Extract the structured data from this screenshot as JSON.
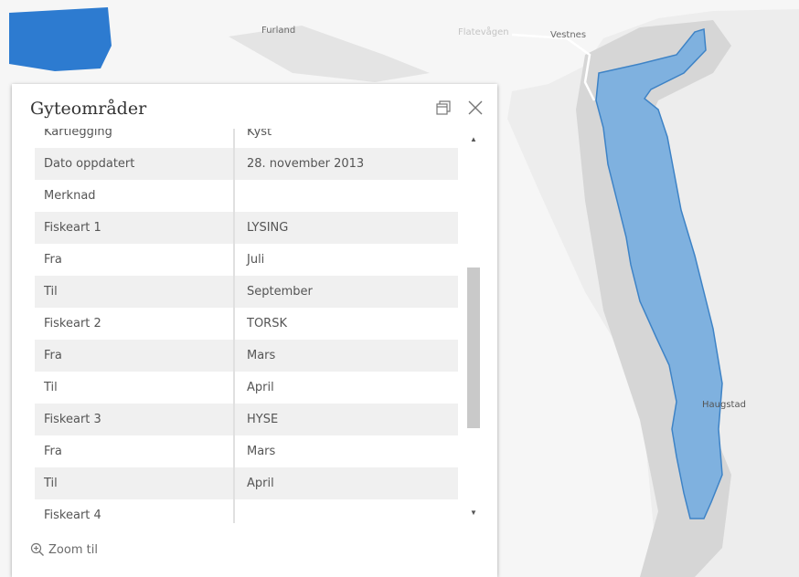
{
  "colors": {
    "map_background": "#ededed",
    "land": "#f6f6f6",
    "water_region": "#2d7bd0",
    "spawning_area_fill": "#7fb1df",
    "spawning_area_stroke": "#3e83c6",
    "popup_background": "#ffffff",
    "row_shaded": "#f0f0f0"
  },
  "map": {
    "labels": {
      "furland": "Furland",
      "flatevagen": "Flatevågen",
      "vestnes": "Vestnes",
      "haugstad": "Haugstad"
    }
  },
  "popup": {
    "title": "Gyteområder",
    "dock_icon": "dock-window-icon",
    "close_icon": "close-icon",
    "rows": [
      {
        "key": "Kartlegging",
        "value": "Kyst"
      },
      {
        "key": "Dato oppdatert",
        "value": "28. november 2013"
      },
      {
        "key": "Merknad",
        "value": ""
      },
      {
        "key": "Fiskeart 1",
        "value": "LYSING"
      },
      {
        "key": "Fra",
        "value": "Juli"
      },
      {
        "key": "Til",
        "value": "September"
      },
      {
        "key": "Fiskeart 2",
        "value": "TORSK"
      },
      {
        "key": "Fra",
        "value": "Mars"
      },
      {
        "key": "Til",
        "value": "April"
      },
      {
        "key": "Fiskeart 3",
        "value": "HYSE"
      },
      {
        "key": "Fra",
        "value": "Mars"
      },
      {
        "key": "Til",
        "value": "April"
      },
      {
        "key": "Fiskeart 4",
        "value": ""
      }
    ],
    "scrollbar": {
      "up_icon": "scroll-up-arrow-icon",
      "down_icon": "scroll-down-arrow-icon"
    },
    "zoom_label": "Zoom til",
    "zoom_icon": "zoom-in-icon"
  }
}
